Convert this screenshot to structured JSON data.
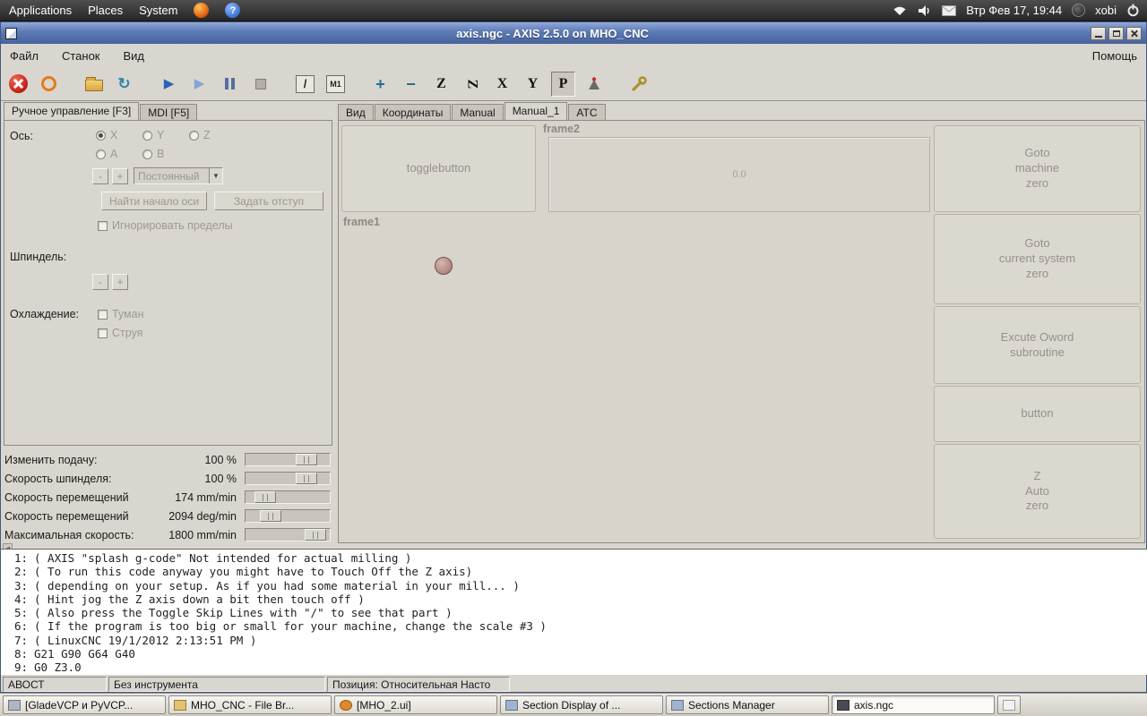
{
  "desktop": {
    "menu_applications": "Applications",
    "menu_places": "Places",
    "menu_system": "System",
    "clock": "Втр Фев 17, 19:44",
    "user": "xobi"
  },
  "icons": {
    "help": "?",
    "reload": "↻",
    "run": "▶",
    "step": "▶",
    "combo_arrow": "▼",
    "scroll_left": "◀"
  },
  "window": {
    "title": "axis.ngc - AXIS 2.5.0 on MHO_CNC"
  },
  "menubar": {
    "file": "Файл",
    "machine": "Станок",
    "view": "Вид",
    "help": "Помощь"
  },
  "toolbar": {
    "skip": "/",
    "optional": "M1",
    "zoom_in": "+",
    "zoom_out": "−",
    "view_z": "Z",
    "view_z2": "Z",
    "view_x": "X",
    "view_y": "Y",
    "view_p": "P"
  },
  "left_panel": {
    "tab_manual": "Ручное управление [F3]",
    "tab_mdi": "MDI [F5]",
    "axis_label": "Ось:",
    "axis_x": "X",
    "axis_y": "Y",
    "axis_z": "Z",
    "axis_a": "A",
    "axis_b": "B",
    "jog_minus": "-",
    "jog_plus": "+",
    "jog_mode": "Постоянный",
    "home_button": "Найти начало оси",
    "offset_button": "Задать отступ",
    "ignore_limits": "Игнорировать пределы",
    "spindle_label": "Шпиндель:",
    "spindle_minus": "-",
    "spindle_plus": "+",
    "coolant_label": "Охлаждение:",
    "mist": "Туман",
    "flood": "Струя",
    "sliders": [
      {
        "label": "Изменить подачу:",
        "value": "100 %"
      },
      {
        "label": "Скорость шпинделя:",
        "value": "100 %"
      },
      {
        "label": "Скорость перемещений",
        "value": "174 mm/min"
      },
      {
        "label": "Скорость перемещений",
        "value": "2094 deg/min"
      },
      {
        "label": "Максимальная скорость:",
        "value": "1800 mm/min"
      }
    ]
  },
  "right_panel": {
    "tabs": [
      {
        "label": "Вид"
      },
      {
        "label": "Координаты"
      },
      {
        "label": "Manual"
      },
      {
        "label": "Manual_1"
      },
      {
        "label": "ATC"
      }
    ],
    "togglebutton": "togglebutton",
    "frame2_label": "frame2",
    "frame2_value": "0.0",
    "frame1_label": "frame1",
    "buttons": [
      {
        "label": "Goto\nmachine\nzero"
      },
      {
        "label": "Goto\ncurrent system\nzero"
      },
      {
        "label": "Excute Oword\nsubroutine"
      },
      {
        "label": "button"
      },
      {
        "label": "Z\nAuto\nzero"
      }
    ]
  },
  "gcode": {
    "lines": [
      {
        "num": "1:",
        "text": "( AXIS \"splash g-code\" Not intended for actual milling )"
      },
      {
        "num": "2:",
        "text": "( To run this code anyway you might have to Touch Off the Z axis)"
      },
      {
        "num": "3:",
        "text": "( depending on your setup. As if you had some material in your mill... )"
      },
      {
        "num": "4:",
        "text": "( Hint jog the Z axis down a bit then touch off )"
      },
      {
        "num": "5:",
        "text": "( Also press the Toggle Skip Lines with \"/\" to see that part )"
      },
      {
        "num": "6:",
        "text": "( If the program is too big or small for your machine, change the scale #3 )"
      },
      {
        "num": "7:",
        "text": "( LinuxCNC 19/1/2012 2:13:51 PM )"
      },
      {
        "num": "8:",
        "text": "G21 G90 G64 G40"
      },
      {
        "num": "9:",
        "text": "G0 Z3.0"
      }
    ]
  },
  "statusbar": {
    "estop": "АВОСТ",
    "tool": "Без инструмента",
    "position": "Позиция: Относительная Насто"
  },
  "taskbar": {
    "items": [
      {
        "label": "[GladeVCP и PyVCP..."
      },
      {
        "label": "MHO_CNC - File Br..."
      },
      {
        "label": "[MHO_2.ui]"
      },
      {
        "label": "Section Display of ..."
      },
      {
        "label": "Sections Manager"
      },
      {
        "label": "axis.ngc"
      }
    ]
  }
}
